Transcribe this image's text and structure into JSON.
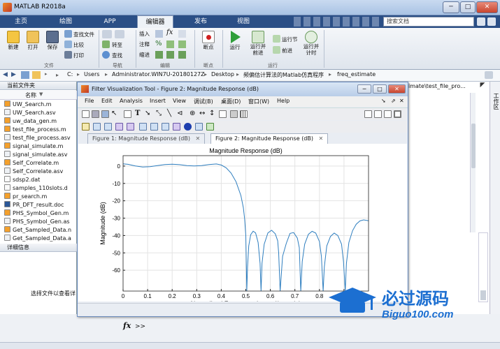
{
  "app": {
    "title": "MATLAB R2018a"
  },
  "window_controls": {
    "minimize": "─",
    "maximize": "□",
    "close": "✕"
  },
  "ribbon_tabs": [
    "主页",
    "绘图",
    "APP",
    "编辑器",
    "发布",
    "视图"
  ],
  "search": {
    "placeholder": "搜索文档"
  },
  "ribbon": {
    "file_group": {
      "new": "新建",
      "open": "打开",
      "save": "保存",
      "find_files": "查找文件",
      "compare": "比较",
      "print": "打印",
      "label": "文件"
    },
    "nav_group": {
      "goto": "转至",
      "find": "查找",
      "label": "导航"
    },
    "edit_group": {
      "insert": "插入",
      "fx": "fx",
      "comment": "注释",
      "pct": "%",
      "indent": "缩进",
      "label": "编辑"
    },
    "breakpoints": {
      "label": "断点",
      "group": "断点"
    },
    "run_group": {
      "run": "运行",
      "run_advance": "运行并\n前进",
      "run_section": "运行节",
      "advance": "前进",
      "run_time": "运行并\n计时",
      "label": "运行"
    }
  },
  "address": {
    "path": [
      "C:",
      "Users",
      "Administrator.WIN7U-20180127Z",
      "Desktop",
      "频偏估计算法的Matlab仿真程序",
      "freq_estimate"
    ]
  },
  "current_folder": {
    "title": "当前文件夹",
    "col_name": "名称",
    "files": [
      {
        "name": "UW_Search.m",
        "kind": "m"
      },
      {
        "name": "UW_Search.asv",
        "kind": "asv"
      },
      {
        "name": "uw_data_gen.m",
        "kind": "m"
      },
      {
        "name": "test_file_process.m",
        "kind": "m"
      },
      {
        "name": "test_file_process.asv",
        "kind": "asv"
      },
      {
        "name": "signal_simulate.m",
        "kind": "m"
      },
      {
        "name": "signal_simulate.asv",
        "kind": "asv"
      },
      {
        "name": "Self_Correlate.m",
        "kind": "m"
      },
      {
        "name": "Self_Correlate.asv",
        "kind": "asv"
      },
      {
        "name": "sdsp2.dat",
        "kind": "dat"
      },
      {
        "name": "samples_110slots.d",
        "kind": "dat"
      },
      {
        "name": "pr_search.m",
        "kind": "m"
      },
      {
        "name": "PR_DFT_result.doc",
        "kind": "doc"
      },
      {
        "name": "PHS_Symbol_Gen.m",
        "kind": "m"
      },
      {
        "name": "PHS_Symbol_Gen.as",
        "kind": "asv"
      },
      {
        "name": "Get_Sampled_Data.n",
        "kind": "m"
      },
      {
        "name": "Get_Sampled_Data.a",
        "kind": "asv"
      }
    ],
    "details_title": "详细信息",
    "details_hint": "选择文件以查看详"
  },
  "editor_path_tail": "imate\\test_file_pro...",
  "workspace_label": "工作区",
  "command": {
    "fx": "fx",
    "prompt": ">>"
  },
  "dialog": {
    "title": "Filter Visualization Tool - Figure 2: Magnitude Response (dB)",
    "menu": [
      "File",
      "Edit",
      "Analysis",
      "Insert",
      "View",
      "调试(B)",
      "桌面(D)",
      "窗口(W)",
      "Help"
    ],
    "tabs": [
      {
        "label": "Figure 1: Magnitude Response (dB)",
        "active": false
      },
      {
        "label": "Figure 2: Magnitude Response (dB)",
        "active": true
      }
    ],
    "tab_close": "✕"
  },
  "chart_data": {
    "type": "line",
    "title": "Magnitude Response (dB)",
    "xlabel": "Normalized Frequency (×π rad/sample)",
    "ylabel": "Magnitude (dB)",
    "xlim": [
      0,
      1
    ],
    "ylim": [
      -72,
      6
    ],
    "xticks": [
      0,
      0.1,
      0.2,
      0.3,
      0.4,
      0.5,
      0.6,
      0.7,
      0.8,
      0.9
    ],
    "yticks": [
      0,
      -10,
      -20,
      -30,
      -40,
      -50,
      -60
    ],
    "grid": true,
    "series": [
      {
        "color": "#2e7ebf",
        "x": [
          0,
          0.02,
          0.05,
          0.08,
          0.11,
          0.14,
          0.17,
          0.2,
          0.23,
          0.26,
          0.29,
          0.32,
          0.35,
          0.38,
          0.4,
          0.42,
          0.44,
          0.46,
          0.48,
          0.49,
          0.495,
          0.5,
          0.504,
          0.507,
          0.512,
          0.52,
          0.53,
          0.54,
          0.55,
          0.558,
          0.562,
          0.566,
          0.575,
          0.59,
          0.605,
          0.62,
          0.63,
          0.634,
          0.64,
          0.65,
          0.665,
          0.68,
          0.695,
          0.71,
          0.718,
          0.724,
          0.73,
          0.74,
          0.755,
          0.77,
          0.785,
          0.8,
          0.808,
          0.815,
          0.82,
          0.83,
          0.845,
          0.86,
          0.875,
          0.89,
          0.898,
          0.905,
          0.91,
          0.92,
          0.935,
          0.95,
          0.965,
          0.98,
          1.0
        ],
        "y": [
          1.3,
          1.0,
          0.1,
          -0.5,
          -0.3,
          0.3,
          0.9,
          1.1,
          0.8,
          0.3,
          0.1,
          0.3,
          0.9,
          1.2,
          0.6,
          -1.0,
          -4.0,
          -9.0,
          -17.0,
          -24.0,
          -30.0,
          -40.0,
          -72,
          -58,
          -46,
          -39.5,
          -37.5,
          -38.5,
          -44,
          -56,
          -72,
          -56,
          -45,
          -38.5,
          -37,
          -39,
          -43,
          -50,
          -72,
          -52,
          -44.5,
          -38.8,
          -38.3,
          -41.5,
          -47,
          -72,
          -55,
          -45,
          -39.3,
          -37.6,
          -38.6,
          -43.5,
          -52,
          -72,
          -58,
          -46,
          -40.5,
          -38.6,
          -40,
          -45,
          -55,
          -72,
          -56,
          -44,
          -37.2,
          -33.5,
          -31.6,
          -31.0,
          -31.5
        ]
      }
    ]
  }
}
